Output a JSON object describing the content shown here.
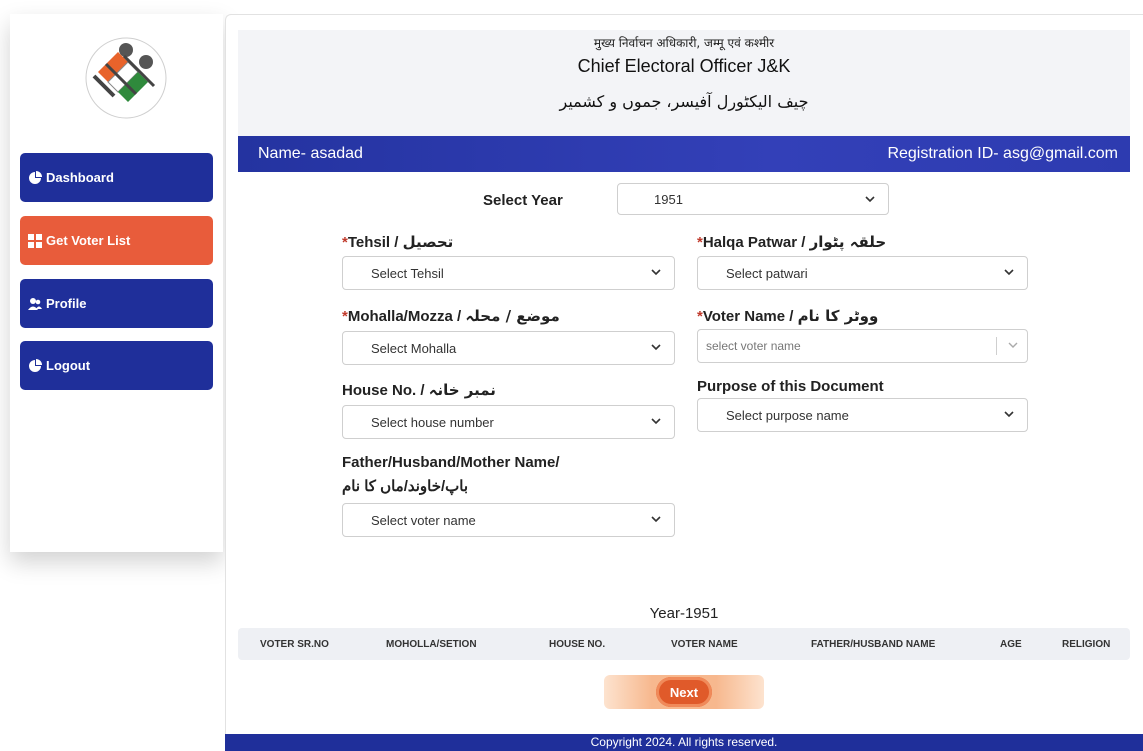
{
  "header": {
    "hindi_title": "मुख्य निर्वाचन अधिकारी, जम्मू एवं कश्मीर",
    "english_title": "Chief Electoral Officer J&K",
    "urdu_title": "چیف الیکٹورل آفیسر، جموں و کشمیر"
  },
  "sidebar": {
    "items": [
      {
        "label": "Dashboard"
      },
      {
        "label": "Get Voter List"
      },
      {
        "label": "Profile"
      },
      {
        "label": "Logout"
      }
    ]
  },
  "user_bar": {
    "name": "Name- asadad",
    "registration": "Registration ID- asg@gmail.com"
  },
  "form": {
    "year_label": "Select Year",
    "year_value": "1951",
    "tehsil_label": "Tehsil / ",
    "tehsil_urdu": "تحصیل",
    "tehsil_placeholder": "Select Tehsil",
    "halqa_label": "Halqa Patwar / ",
    "halqa_urdu": "حلقہ پٹوار",
    "halqa_placeholder": "Select patwari",
    "mohalla_label": "Mohalla/Mozza / ",
    "mohalla_urdu": "موضع / محلہ",
    "mohalla_placeholder": "Select Mohalla",
    "voter_label": "Voter Name / ",
    "voter_urdu": "ووٹر کا نام",
    "voter_placeholder": "select voter name",
    "house_label": "House No. / ",
    "house_urdu": "نمبر خانہ",
    "house_placeholder": "Select house number",
    "purpose_label": "Purpose of this Document",
    "purpose_placeholder": "Select purpose name",
    "father_label": "Father/Husband/Mother Name/",
    "father_urdu": "باپ/خاوند/ماں کا نام",
    "father_placeholder": "Select voter name"
  },
  "table": {
    "title": "Year-1951",
    "columns": [
      "VOTER SR.NO",
      "MOHOLLA/SETION",
      "HOUSE NO.",
      "VOTER NAME",
      "FATHER/HUSBAND NAME",
      "AGE",
      "RELIGION"
    ]
  },
  "actions": {
    "next_label": "Next"
  },
  "footer": {
    "text": "Copyright 2024. All rights reserved."
  },
  "colors": {
    "primary": "#1f2f9a",
    "accent": "#e85c3b"
  },
  "icons": {
    "dashboard": "pie-chart-icon",
    "voter_list": "grid-icon",
    "profile": "users-icon",
    "logout": "pie-chart-icon"
  }
}
